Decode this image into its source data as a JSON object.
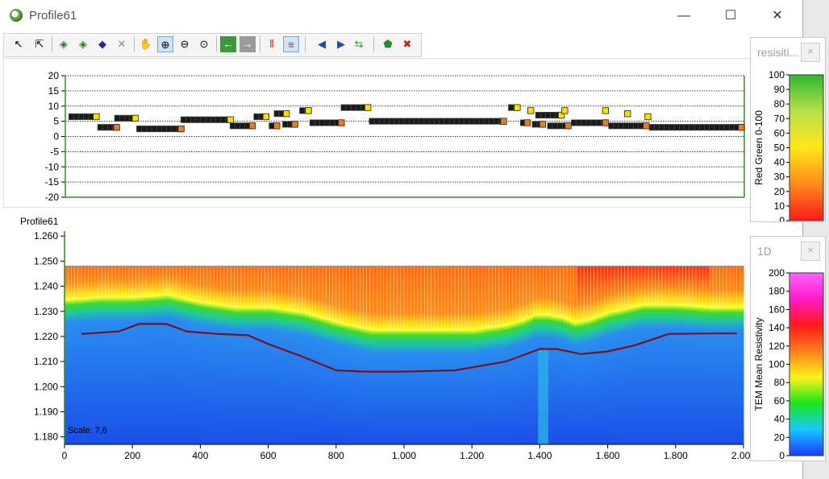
{
  "window": {
    "title": "Profile61",
    "min": "—",
    "max": "☐",
    "close": "✕"
  },
  "toolbar": {
    "icons": [
      "select-arrow-icon",
      "select-multi-icon",
      "layer-a-icon",
      "layer-b-icon",
      "layer-c-icon",
      "delete-icon",
      "pan-hand-icon",
      "zoom-in-icon",
      "zoom-out-icon",
      "zoom-extent-icon",
      "back-icon",
      "forward-icon",
      "vertical-bars-icon",
      "horizontal-lines-icon",
      "prev-icon",
      "next-icon",
      "swap-icon",
      "enable-icon",
      "disable-icon"
    ]
  },
  "top_chart": {
    "yticks": [
      "20",
      "15",
      "10",
      "5",
      "0",
      "-5",
      "-10",
      "-15",
      "-20"
    ]
  },
  "section_chart": {
    "label": "Profile61",
    "yticks": [
      "1.260",
      "1.250",
      "1.240",
      "1.230",
      "1.220",
      "1.210",
      "1.200",
      "1.190",
      "1.180"
    ],
    "xticks": [
      "0",
      "200",
      "400",
      "600",
      "800",
      "1.000",
      "1.200",
      "1.400",
      "1.600",
      "1.800",
      "2.000"
    ],
    "scale_text": "Scale: 7,6"
  },
  "colorbar1": {
    "title": "resisiti...",
    "close": "×",
    "label": "Red Green 0-100",
    "ticks": [
      "100",
      "90",
      "80",
      "70",
      "60",
      "50",
      "40",
      "30",
      "20",
      "10",
      "0"
    ]
  },
  "colorbar2": {
    "title": "1D",
    "close": "×",
    "label": "TEM Mean Resistivity",
    "ticks": [
      "200",
      "180",
      "160",
      "140",
      "120",
      "100",
      "80",
      "60",
      "40",
      "20",
      "0"
    ]
  },
  "chart_data": [
    {
      "type": "scatter",
      "yticks": [
        "20",
        "15",
        "10",
        "5",
        "0",
        "-5",
        "-10",
        "-15",
        "-20"
      ],
      "ylim": [
        -20,
        20
      ],
      "xlim": [
        0,
        2000
      ],
      "series": [
        {
          "marker": "square",
          "color_dark": "#111111",
          "color_yellow": "#f5e000",
          "color_orange": "#f07a1a"
        }
      ],
      "segments": [
        {
          "x0": 10,
          "x1": 100,
          "y": 6.5,
          "end": "yellow"
        },
        {
          "x0": 95,
          "x1": 160,
          "y": 3,
          "end": "orange"
        },
        {
          "x0": 145,
          "x1": 215,
          "y": 6,
          "end": "yellow"
        },
        {
          "x0": 210,
          "x1": 350,
          "y": 2.5,
          "end": "orange"
        },
        {
          "x0": 340,
          "x1": 495,
          "y": 5.5,
          "end": "yellow"
        },
        {
          "x0": 485,
          "x1": 560,
          "y": 3.5,
          "end": "orange"
        },
        {
          "x0": 555,
          "x1": 600,
          "y": 6.5,
          "end": "yellow"
        },
        {
          "x0": 600,
          "x1": 632,
          "y": 3.5,
          "end": "orange"
        },
        {
          "x0": 615,
          "x1": 660,
          "y": 7.5,
          "end": "yellow"
        },
        {
          "x0": 640,
          "x1": 685,
          "y": 4,
          "end": "orange"
        },
        {
          "x0": 690,
          "x1": 725,
          "y": 8.5,
          "end": "yellow"
        },
        {
          "x0": 720,
          "x1": 822,
          "y": 4.5,
          "end": "orange"
        },
        {
          "x0": 812,
          "x1": 900,
          "y": 9.5,
          "end": "yellow"
        },
        {
          "x0": 895,
          "x1": 1300,
          "y": 5,
          "end": "orange"
        },
        {
          "x0": 1305,
          "x1": 1340,
          "y": 9.5,
          "end": "yellow"
        },
        {
          "x0": 1340,
          "x1": 1370,
          "y": 4.5,
          "end": "orange"
        },
        {
          "x0": 1360,
          "x1": 1380,
          "y": 8.5,
          "end": "yellow"
        },
        {
          "x0": 1375,
          "x1": 1415,
          "y": 4,
          "end": "orange"
        },
        {
          "x0": 1385,
          "x1": 1470,
          "y": 7,
          "end": "yellow"
        },
        {
          "x0": 1420,
          "x1": 1490,
          "y": 3.5,
          "end": "orange"
        },
        {
          "x0": 1465,
          "x1": 1480,
          "y": 8.5,
          "end": "yellow"
        },
        {
          "x0": 1490,
          "x1": 1600,
          "y": 4.5,
          "end": "orange"
        },
        {
          "x0": 1590,
          "x1": 1600,
          "y": 8.5,
          "end": "yellow"
        },
        {
          "x0": 1600,
          "x1": 1720,
          "y": 3.5,
          "end": "orange"
        },
        {
          "x0": 1650,
          "x1": 1665,
          "y": 7.5,
          "end": "yellow"
        },
        {
          "x0": 1710,
          "x1": 1725,
          "y": 6.5,
          "end": "yellow"
        },
        {
          "x0": 1720,
          "x1": 2000,
          "y": 3,
          "end": "orange"
        }
      ]
    },
    {
      "type": "heatmap",
      "x_unit": "distance",
      "xlim": [
        0,
        2000
      ],
      "ylim": [
        1.177,
        1.262
      ],
      "yticks": [
        "1.260",
        "1.250",
        "1.240",
        "1.230",
        "1.220",
        "1.210",
        "1.200",
        "1.190",
        "1.180"
      ],
      "xticks": [
        "0",
        "200",
        "400",
        "600",
        "800",
        "1.000",
        "1.200",
        "1.400",
        "1.600",
        "1.800",
        "2.000"
      ],
      "surface_elevation": 1.248,
      "interface_line": {
        "color": "#7a1020",
        "x": [
          50,
          100,
          160,
          220,
          300,
          360,
          450,
          540,
          600,
          700,
          800,
          880,
          1000,
          1150,
          1300,
          1400,
          1450,
          1520,
          1600,
          1680,
          1780,
          1900,
          1980
        ],
        "y": [
          1.221,
          1.2215,
          1.222,
          1.225,
          1.225,
          1.222,
          1.221,
          1.2205,
          1.217,
          1.212,
          1.2065,
          1.206,
          1.206,
          1.2065,
          1.21,
          1.215,
          1.215,
          1.213,
          1.214,
          1.2165,
          1.221,
          1.2212,
          1.2212
        ]
      },
      "yellow_boundary": {
        "x": [
          0,
          100,
          200,
          300,
          400,
          500,
          600,
          700,
          800,
          900,
          1000,
          1100,
          1200,
          1300,
          1350,
          1380,
          1420,
          1460,
          1500,
          1540,
          1600,
          1700,
          1800,
          1900,
          2000
        ],
        "y": [
          1.235,
          1.236,
          1.236,
          1.237,
          1.234,
          1.232,
          1.232,
          1.23,
          1.226,
          1.223,
          1.223,
          1.223,
          1.223,
          1.225,
          1.227,
          1.229,
          1.229,
          1.228,
          1.226,
          1.227,
          1.23,
          1.233,
          1.233,
          1.232,
          1.232
        ]
      }
    },
    {
      "type": "colorbar",
      "label": "Red Green 0-100",
      "range": [
        0,
        100
      ],
      "colors": [
        "#ff1a1a",
        "#ff8a1a",
        "#ffe61a",
        "#b8e04a",
        "#2eb82e"
      ]
    },
    {
      "type": "colorbar",
      "label": "TEM Mean Resistivity",
      "range": [
        0,
        200
      ],
      "colors": [
        "#1a3cff",
        "#19c8ff",
        "#19e61a",
        "#fff31a",
        "#ff7f1a",
        "#ff1a1a",
        "#ff1ac8",
        "#ff66ff"
      ]
    }
  ]
}
